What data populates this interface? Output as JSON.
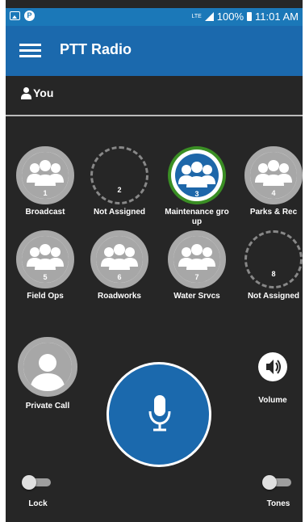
{
  "status_bar": {
    "network": "LTE",
    "battery": "100%",
    "time": "11:01 AM"
  },
  "app_bar": {
    "title": "PTT Radio",
    "menu_icon": "hamburger-icon"
  },
  "user": {
    "label": "You",
    "icon": "person-icon"
  },
  "channels": [
    {
      "number": "1",
      "label": "Broadcast",
      "state": "assigned"
    },
    {
      "number": "2",
      "label": "Not Assigned",
      "state": "empty"
    },
    {
      "number": "3",
      "label": "Maintenance gro up",
      "state": "active"
    },
    {
      "number": "4",
      "label": "Parks & Rec",
      "state": "assigned"
    },
    {
      "number": "5",
      "label": "Field Ops",
      "state": "assigned"
    },
    {
      "number": "6",
      "label": "Roadworks",
      "state": "assigned"
    },
    {
      "number": "7",
      "label": "Water Srvcs",
      "state": "assigned"
    },
    {
      "number": "8",
      "label": "Not Assigned",
      "state": "empty"
    }
  ],
  "private_call": {
    "label": "Private Call",
    "icon": "person-icon"
  },
  "ptt_button": {
    "icon": "microphone-icon"
  },
  "volume": {
    "label": "Volume",
    "icon": "speaker-icon"
  },
  "lock": {
    "label": "Lock",
    "on": false
  },
  "tones": {
    "label": "Tones",
    "on": false
  },
  "colors": {
    "status_bar": "#1b78b8",
    "app_bar": "#1b69ad",
    "background": "#262626",
    "active_ring": "#3a8e24",
    "ptt_button": "#1b69ad"
  }
}
